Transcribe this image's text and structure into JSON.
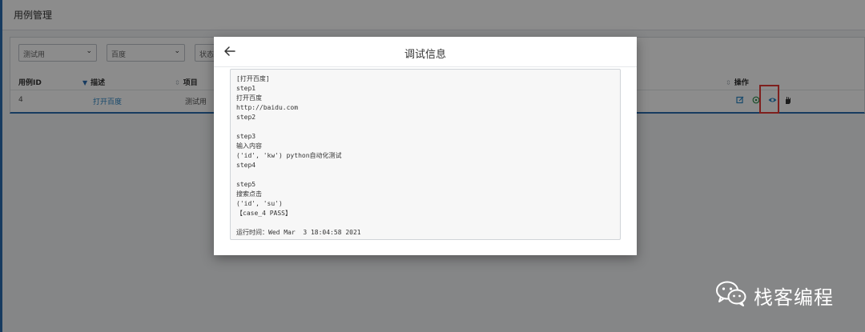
{
  "page": {
    "title": "用例管理"
  },
  "filters": [
    {
      "value": "测试用"
    },
    {
      "value": "百度"
    },
    {
      "value": "状态"
    }
  ],
  "table": {
    "columns": [
      "用例ID",
      "描述",
      "项目",
      "操作"
    ],
    "rows": [
      {
        "id": "4",
        "desc": "打开百度",
        "project": "测试用"
      }
    ],
    "actions": [
      "edit-icon",
      "run-icon",
      "view-icon",
      "hand-icon"
    ]
  },
  "modal": {
    "title": "调试信息",
    "log_lines": [
      "[打开百度]",
      "step1",
      "打开百度",
      "http://baidu.com",
      "step2",
      "",
      "step3",
      "输入内容",
      "('id', 'kw') python自动化测试",
      "step4",
      "",
      "step5",
      "搜索点击",
      "('id', 'su')",
      "【case_4 PASS】",
      "",
      "运行时间：Wed Mar  3 18:04:58 2021"
    ]
  },
  "watermark": {
    "text": "栈客编程",
    "icon": "wechat-icon"
  },
  "colors": {
    "accent": "#2b6cb0",
    "highlight": "#e53935",
    "link": "#2b86c5"
  }
}
